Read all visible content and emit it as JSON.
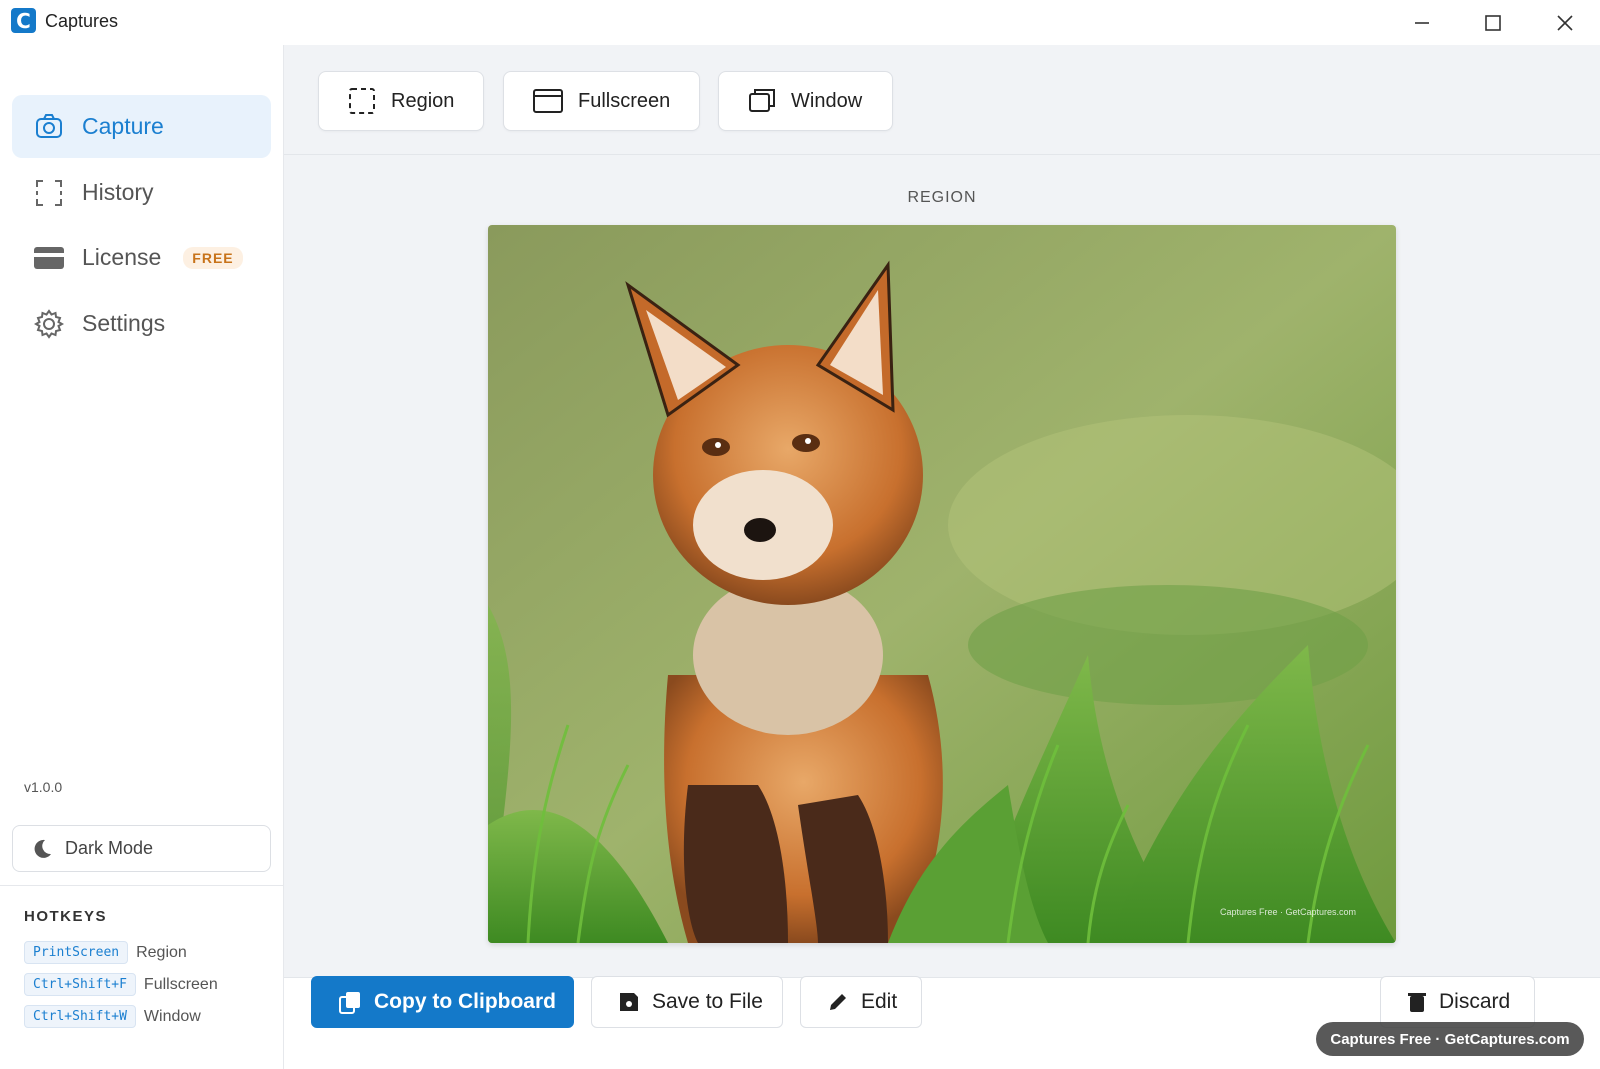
{
  "window": {
    "title": "Captures",
    "logo_letter": "C"
  },
  "sidebar": {
    "items": [
      {
        "label": "Capture",
        "icon": "camera-icon",
        "active": true
      },
      {
        "label": "History",
        "icon": "history-frame-icon",
        "active": false
      },
      {
        "label": "License",
        "icon": "credit-card-icon",
        "active": false,
        "badge": "FREE"
      },
      {
        "label": "Settings",
        "icon": "gear-icon",
        "active": false
      }
    ],
    "version": "v1.0.0",
    "dark_mode_label": "Dark Mode",
    "hotkeys_title": "HOTKEYS",
    "hotkeys": [
      {
        "key": "PrintScreen",
        "action": "Region"
      },
      {
        "key": "Ctrl+Shift+F",
        "action": "Fullscreen"
      },
      {
        "key": "Ctrl+Shift+W",
        "action": "Window"
      }
    ]
  },
  "toolbar": {
    "region_label": "Region",
    "fullscreen_label": "Fullscreen",
    "window_label": "Window"
  },
  "preview": {
    "mode_label": "REGION",
    "image_watermark": "Captures Free · GetCaptures.com"
  },
  "actions": {
    "copy_label": "Copy to Clipboard",
    "save_label": "Save to File",
    "edit_label": "Edit",
    "discard_label": "Discard"
  },
  "watermark": {
    "text": "Captures Free · GetCaptures.com"
  },
  "colors": {
    "accent": "#1479c9",
    "badge_text": "#c8731a",
    "active_bg": "#e8f2fc"
  }
}
